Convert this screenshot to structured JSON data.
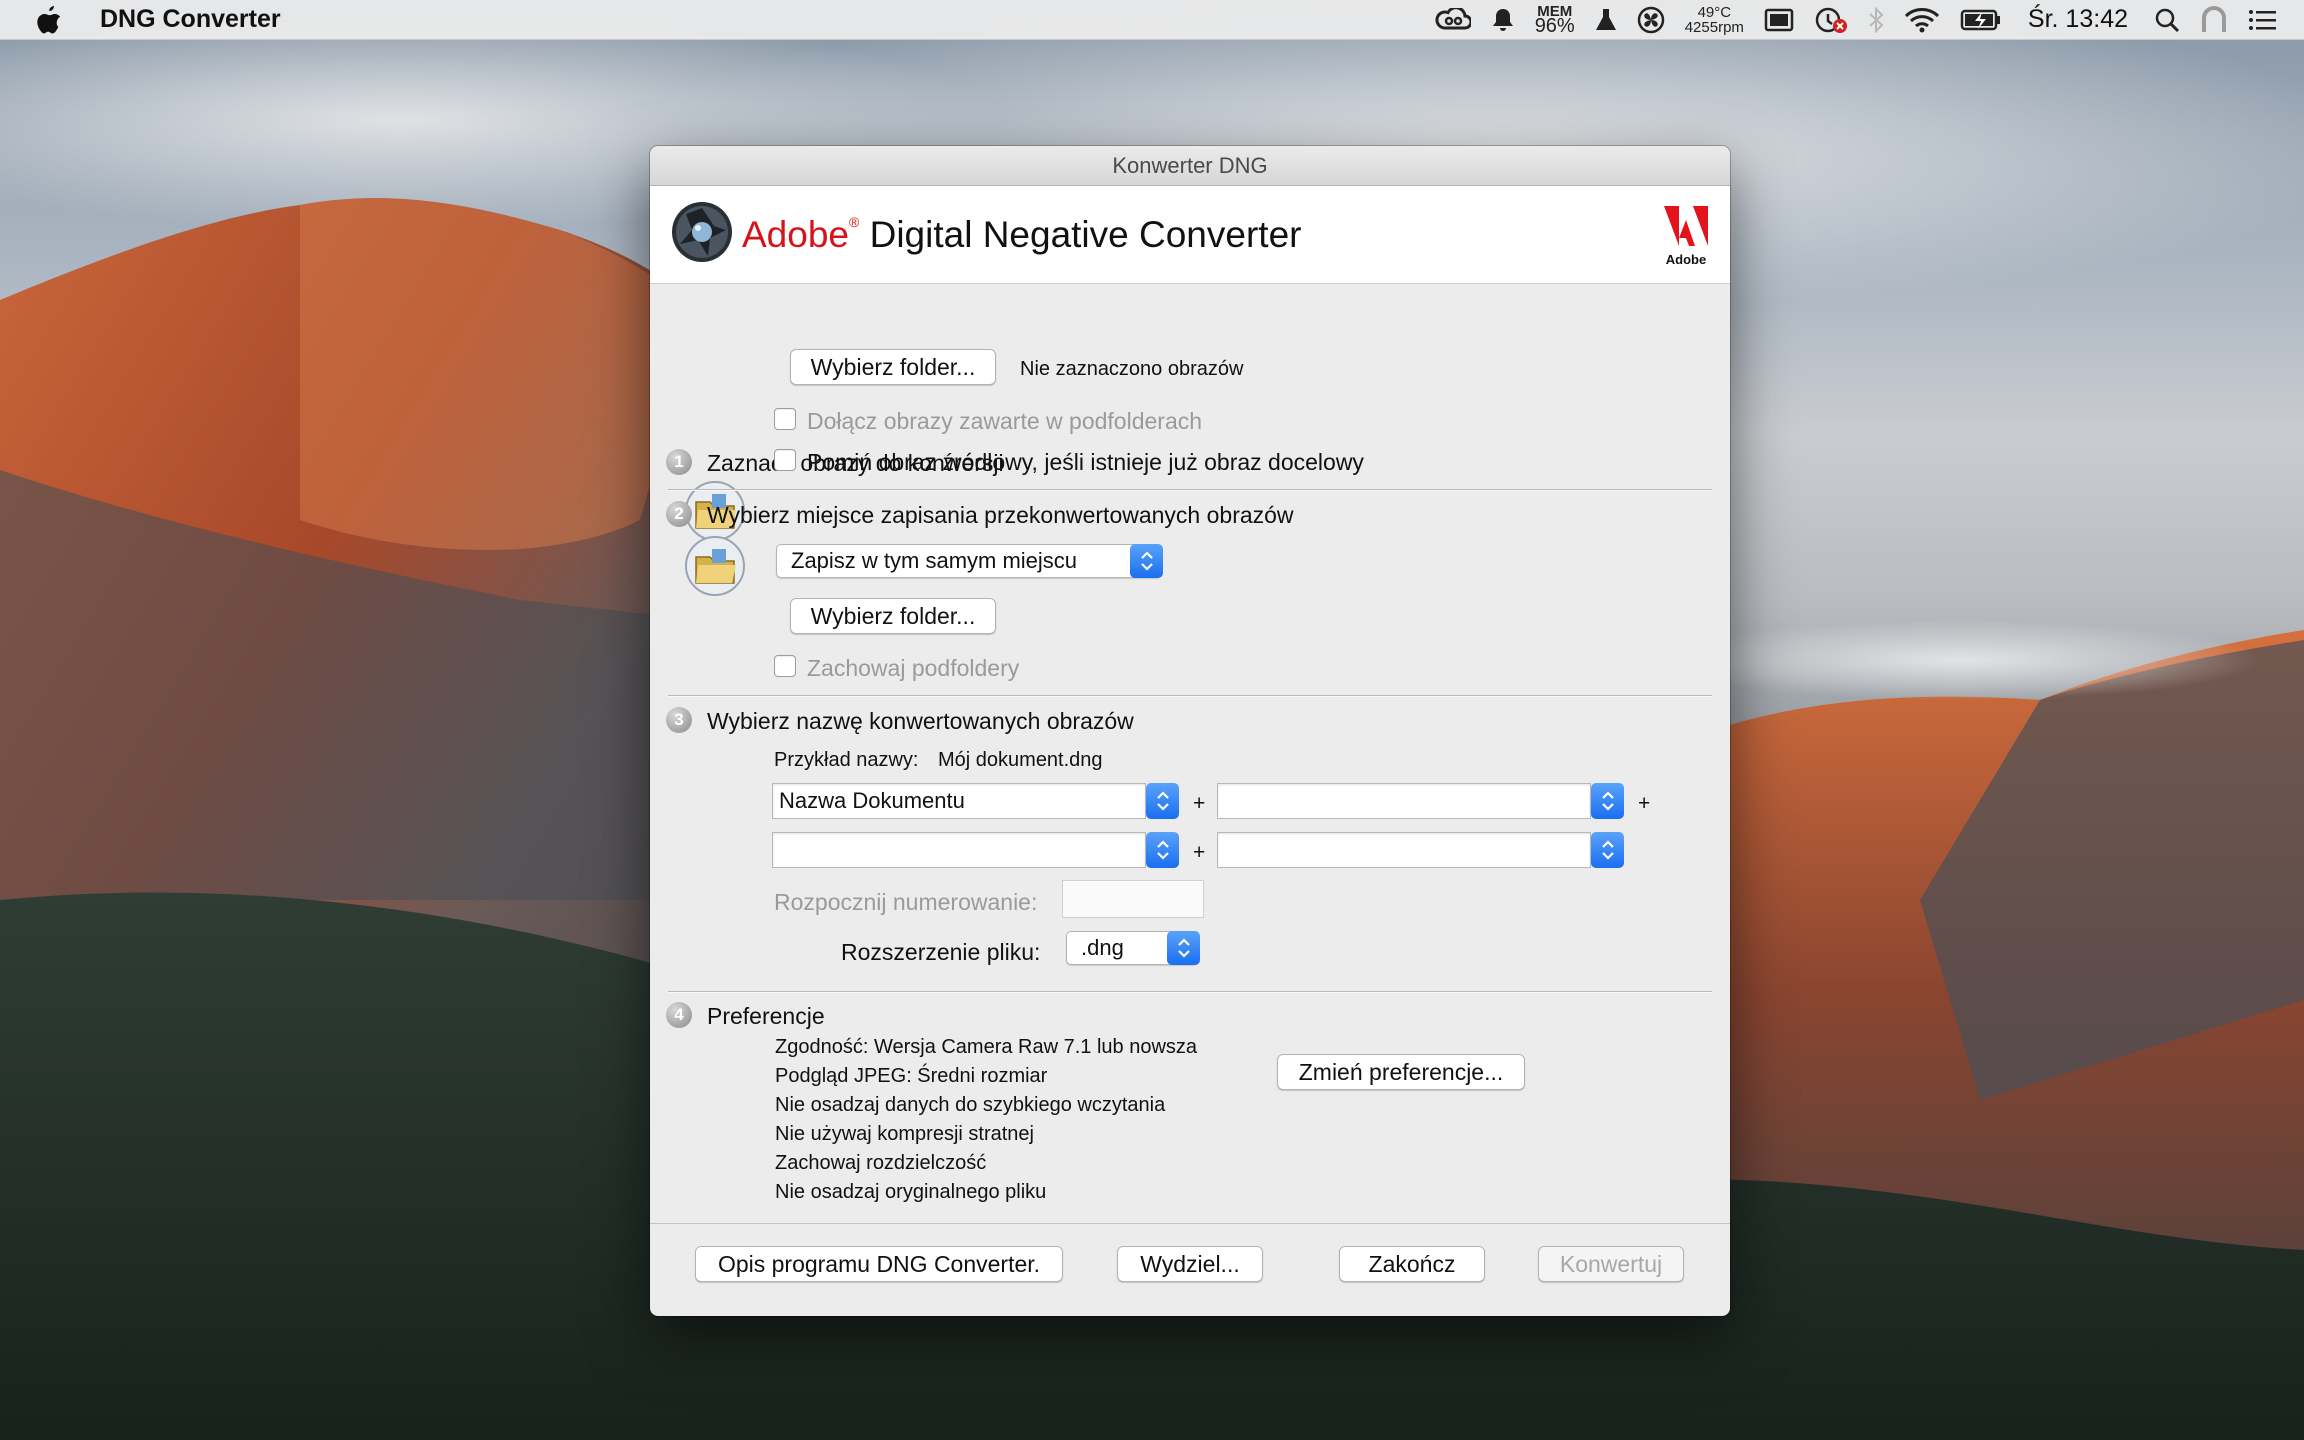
{
  "menubar": {
    "app_name": "DNG Converter",
    "mem_label": "MEM",
    "mem_value": "96%",
    "temp": "49°C",
    "fan": "4255rpm",
    "clock": "Śr. 13:42"
  },
  "window": {
    "title": "Konwerter DNG",
    "banner_adobe": "Adobe",
    "banner_reg": "®",
    "banner_rest": " Digital Negative Converter",
    "adobe_logo_label": "Adobe"
  },
  "section1": {
    "number": "1",
    "title": "Zaznacz obrazy do konwersji",
    "choose_folder": "Wybierz folder...",
    "status": "Nie zaznaczono obrazów",
    "include_subfolders": "Dołącz obrazy zawarte w podfolderach",
    "skip_source": "Pomiń obraz źródłowy, jeśli istnieje już obraz docelowy"
  },
  "section2": {
    "number": "2",
    "title": "Wybierz miejsce zapisania przekonwertowanych obrazów",
    "location_select": "Zapisz w tym samym miejscu",
    "choose_folder": "Wybierz folder...",
    "keep_subfolders": "Zachowaj podfoldery"
  },
  "section3": {
    "number": "3",
    "title": "Wybierz nazwę konwertowanych obrazów",
    "example_label": "Przykład nazwy:",
    "example_value": "Mój dokument.dng",
    "name_field_1": "Nazwa Dokumentu",
    "name_field_2": "",
    "name_field_3": "",
    "name_field_4": "",
    "plus": "+",
    "start_numbering": "Rozpocznij numerowanie:",
    "start_numbering_value": "",
    "extension_label": "Rozszerzenie pliku:",
    "extension_value": ".dng"
  },
  "section4": {
    "number": "4",
    "title": "Preferencje",
    "prefs": [
      "Zgodność: Wersja Camera Raw 7.1 lub nowsza",
      "Podgląd JPEG: Średni rozmiar",
      "Nie osadzaj danych do szybkiego wczytania",
      "Nie używaj kompresji stratnej",
      "Zachowaj rozdzielczość",
      "Nie osadzaj oryginalnego pliku"
    ],
    "change_prefs": "Zmień preferencje..."
  },
  "footer": {
    "about": "Opis programu DNG Converter.",
    "extract": "Wydziel...",
    "quit": "Zakończ",
    "convert": "Konwertuj"
  }
}
